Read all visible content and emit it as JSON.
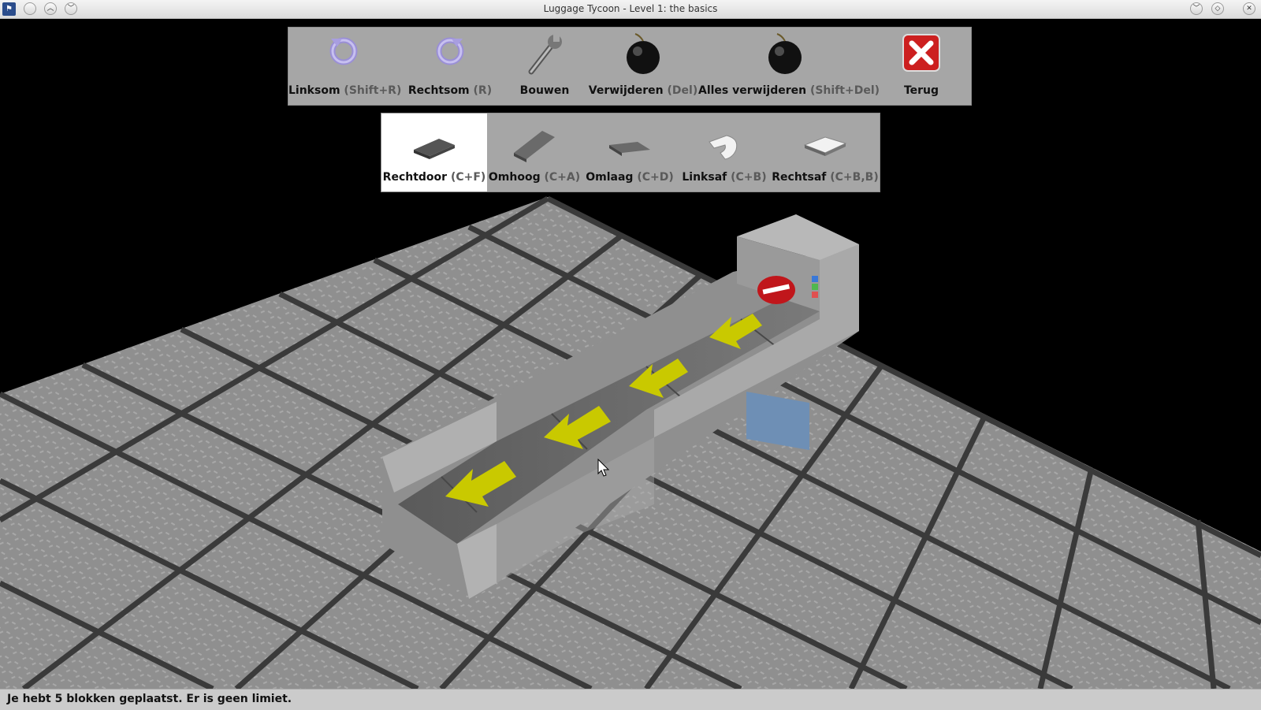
{
  "window": {
    "title": "Luggage Tycoon - Level 1: the basics"
  },
  "toolbar": {
    "tools": [
      {
        "label": "Linksom",
        "shortcut": "(Shift+R)",
        "icon": "rotate-left-icon"
      },
      {
        "label": "Rechtsom",
        "shortcut": "(R)",
        "icon": "rotate-right-icon"
      },
      {
        "label": "Bouwen",
        "shortcut": "",
        "icon": "wrench-icon"
      },
      {
        "label": "Verwijderen",
        "shortcut": "(Del)",
        "icon": "bomb-icon"
      },
      {
        "label": "Alles verwijderen",
        "shortcut": "(Shift+Del)",
        "icon": "bomb-icon"
      },
      {
        "label": "Terug",
        "shortcut": "",
        "icon": "close-icon"
      }
    ]
  },
  "blocks": {
    "selected_index": 0,
    "items": [
      {
        "label": "Rechtdoor",
        "shortcut": "(C+F)",
        "icon": "straight-block-icon"
      },
      {
        "label": "Omhoog",
        "shortcut": "(C+A)",
        "icon": "ramp-up-block-icon"
      },
      {
        "label": "Omlaag",
        "shortcut": "(C+D)",
        "icon": "ramp-down-block-icon"
      },
      {
        "label": "Linksaf",
        "shortcut": "(C+B)",
        "icon": "turn-left-block-icon"
      },
      {
        "label": "Rechtsaf",
        "shortcut": "(C+B,B)",
        "icon": "turn-right-block-icon"
      }
    ]
  },
  "status": {
    "message": "Je hebt 5 blokken geplaatst. Er is geen limiet."
  },
  "colors": {
    "toolbar_bg": "#a6a6a6",
    "selected_bg": "#ffffff",
    "arrow": "#c9c900",
    "floor": "#8e8e8e",
    "stop_sign": "#c0161b"
  }
}
